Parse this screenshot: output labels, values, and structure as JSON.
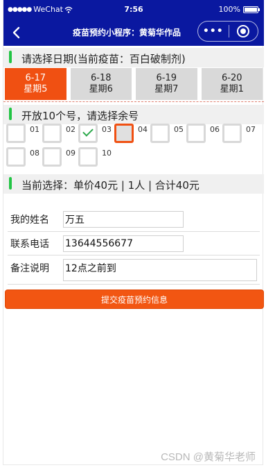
{
  "status_bar": {
    "signal": "●●●●●",
    "carrier": "WeChat",
    "time": "7:56",
    "battery": "100%"
  },
  "nav": {
    "title": "疫苗预约小程序：黄菊华作品",
    "more_label": "•••"
  },
  "date_section": {
    "title": "请选择日期(当前疫苗：百白破制剂)"
  },
  "dates": [
    {
      "date": "6-17",
      "weekday": "星期5",
      "active": true
    },
    {
      "date": "6-18",
      "weekday": "星期6",
      "active": false
    },
    {
      "date": "6-19",
      "weekday": "星期7",
      "active": false
    },
    {
      "date": "6-20",
      "weekday": "星期1",
      "active": false
    }
  ],
  "slot_section": {
    "title": "开放10个号，请选择余号"
  },
  "slots": [
    {
      "number": "01",
      "state": "empty"
    },
    {
      "number": "02",
      "state": "empty"
    },
    {
      "number": "03",
      "state": "checked"
    },
    {
      "number": "04",
      "state": "selected"
    },
    {
      "number": "05",
      "state": "empty"
    },
    {
      "number": "06",
      "state": "empty"
    },
    {
      "number": "07",
      "state": "empty"
    },
    {
      "number": "08",
      "state": "empty"
    },
    {
      "number": "09",
      "state": "empty"
    },
    {
      "number": "10",
      "state": "empty"
    }
  ],
  "selection_section": {
    "title": "当前选择：单价40元 | 1人 | 合计40元"
  },
  "form": {
    "name_label": "我的姓名",
    "name_value": "万五",
    "phone_label": "联系电话",
    "phone_value": "13644556677",
    "note_label": "备注说明",
    "note_value": "12点之前到"
  },
  "submit_label": "提交疫苗预约信息",
  "watermark": "CSDN @黄菊华老师",
  "colors": {
    "nav_bg": "#0a18a0",
    "accent": "#f05012",
    "section_marker": "#22c444",
    "check": "#2aa84a"
  }
}
